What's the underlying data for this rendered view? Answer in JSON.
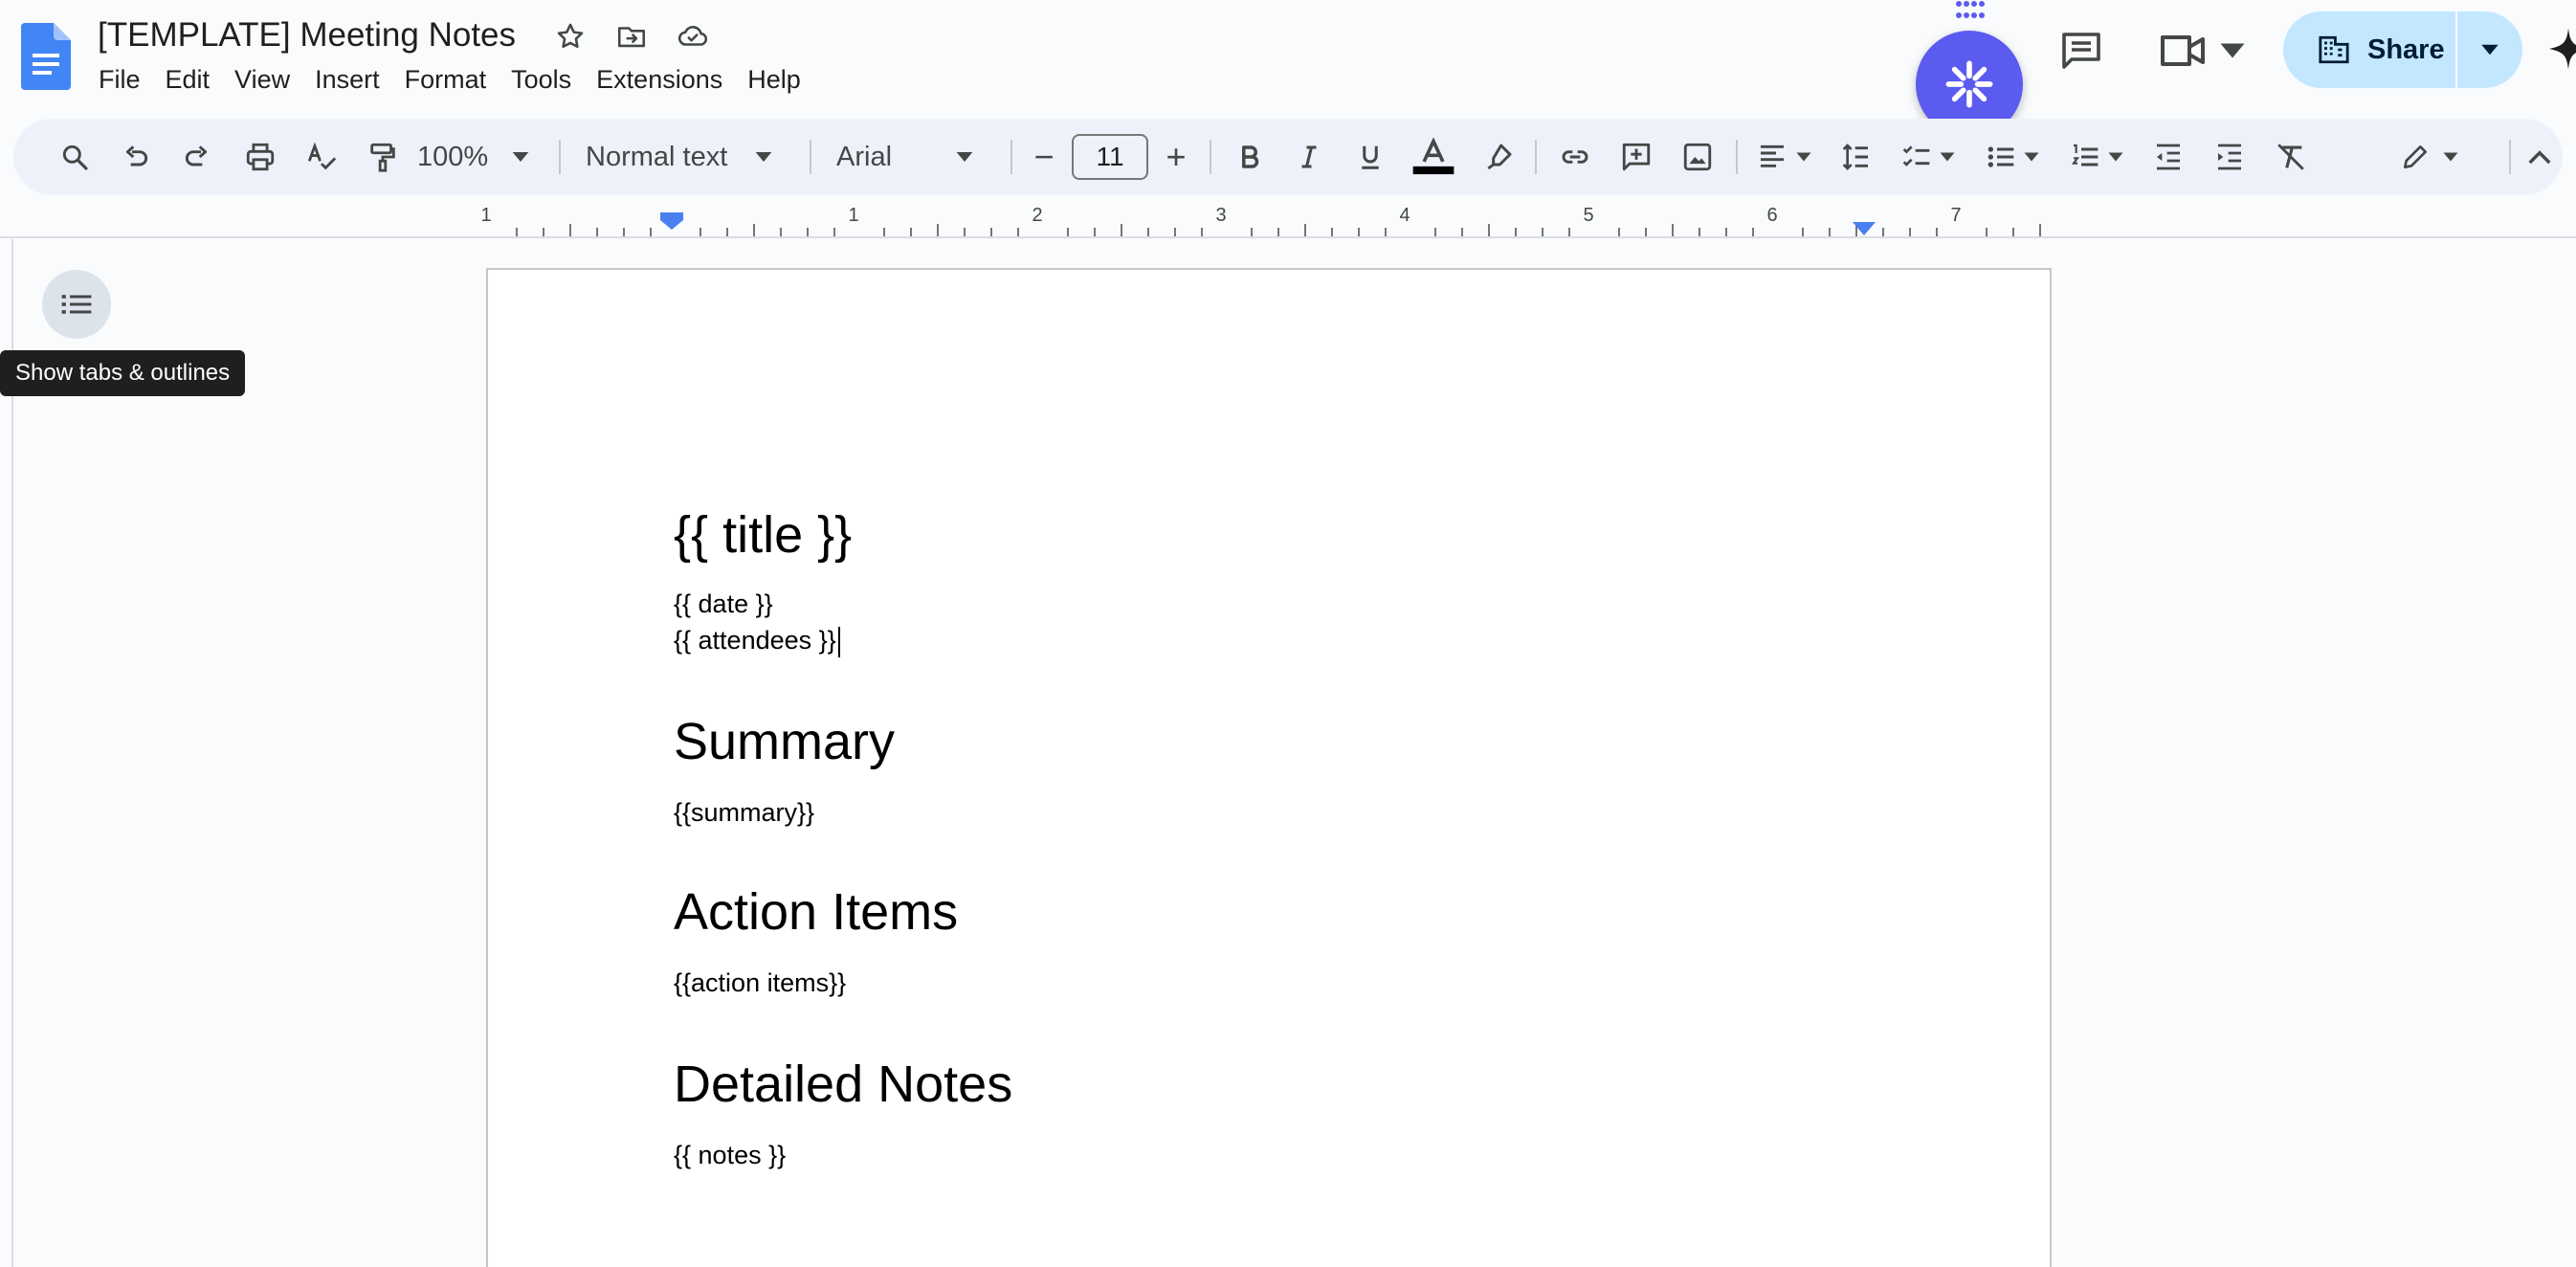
{
  "document": {
    "title": "[TEMPLATE] Meeting Notes"
  },
  "menu": {
    "items": [
      "File",
      "Edit",
      "View",
      "Insert",
      "Format",
      "Tools",
      "Extensions",
      "Help"
    ]
  },
  "header": {
    "share_label": "Share"
  },
  "toolbar": {
    "zoom": "100%",
    "paragraph_style": "Normal text",
    "font_family": "Arial",
    "font_size": "11",
    "decrease_font_size": "−",
    "increase_font_size": "+"
  },
  "ruler": {
    "labels": [
      "1",
      "1",
      "2",
      "3",
      "4",
      "5",
      "6",
      "7"
    ]
  },
  "side_panel": {
    "tooltip": "Show tabs & outlines"
  },
  "content": {
    "title": "{{ title }}",
    "date": "{{ date }}",
    "attendees": "{{ attendees }}",
    "summary_heading": "Summary",
    "summary_body": "{{summary}}",
    "action_items_heading": "Action Items",
    "action_items_body": "{{action items}}",
    "detailed_notes_heading": "Detailed Notes",
    "notes_body": "{{ notes }}"
  },
  "colors": {
    "accent": "#0b57d0",
    "share_bg": "#c2e7ff",
    "toolbar_bg": "#edf2fa",
    "ai_button": "#5b5bf0",
    "docs_blue": "#4285f4"
  },
  "icons": {
    "app": "google-docs-icon",
    "star": "star-icon",
    "move": "move-to-folder-icon",
    "cloud": "cloud-saved-icon",
    "comments": "comments-icon",
    "meet": "video-camera-icon",
    "share": "building-icon",
    "ai": "ai-assistant-icon",
    "gemini": "gemini-icon",
    "outline": "list-outline-icon"
  }
}
